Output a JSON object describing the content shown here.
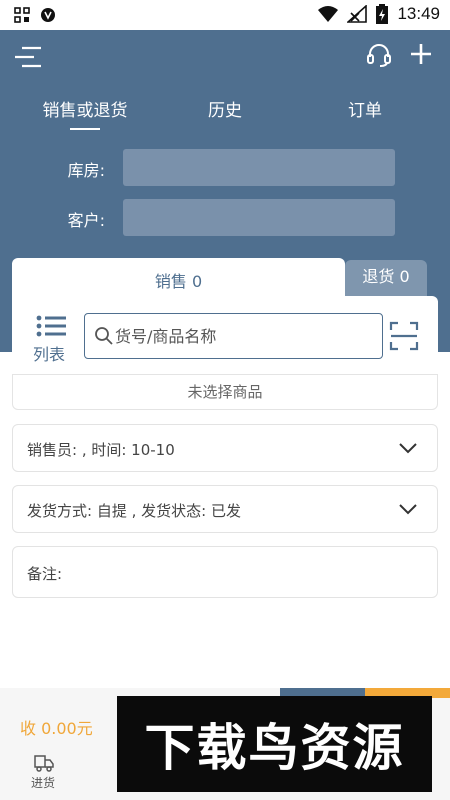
{
  "status_bar": {
    "time": "13:49"
  },
  "header": {
    "tabs": [
      "销售或退货",
      "历史",
      "订单"
    ],
    "warehouse_label": "库房:",
    "customer_label": "客户:"
  },
  "cart_tabs": {
    "sale": "销售 0",
    "return": "退货 0"
  },
  "goods": {
    "list_label": "列表",
    "search_placeholder": "货号/商品名称",
    "empty": "未选择商品"
  },
  "info": {
    "seller": "销售员: , 时间: 10-10",
    "shipping": "发货方式: 自提 , 发货状态: 已发",
    "remark": "备注:"
  },
  "bottom": {
    "total": "收 0.00元",
    "stock": "进货"
  },
  "watermark": "下载鸟资源",
  "colors": {
    "primary": "#4f6f8f",
    "accent": "#f3a93a"
  }
}
